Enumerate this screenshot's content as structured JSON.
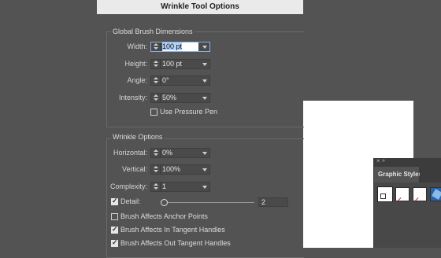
{
  "dialog": {
    "title": "Wrinkle Tool Options"
  },
  "global_brush": {
    "title": "Global Brush Dimensions",
    "width": {
      "label": "Width:",
      "value": "100 pt"
    },
    "height": {
      "label": "Height:",
      "value": "100 pt"
    },
    "angle": {
      "label": "Angle:",
      "value": "0°"
    },
    "intensity": {
      "label": "Intensity:",
      "value": "50%"
    },
    "pressure_pen": {
      "label": "Use Pressure Pen",
      "checked": false
    }
  },
  "wrinkle": {
    "title": "Wrinkle Options",
    "horizontal": {
      "label": "Horizontal:",
      "value": "0%"
    },
    "vertical": {
      "label": "Vertical:",
      "value": "100%"
    },
    "complexity": {
      "label": "Complexity:",
      "value": "1"
    },
    "detail": {
      "label": "Detail:",
      "value": "2",
      "checked": true,
      "slider_fraction": 0.0
    },
    "anchor_points": {
      "label": "Brush Affects Anchor Points",
      "checked": false
    },
    "in_tangent": {
      "label": "Brush Affects In Tangent Handles",
      "checked": true
    },
    "out_tangent": {
      "label": "Brush Affects Out Tangent Handles",
      "checked": true
    }
  },
  "graphic_styles": {
    "tab_label": "Graphic Styles",
    "close_glyph": "×",
    "collapse_glyph": "»"
  },
  "colors": {
    "background": "#535353",
    "title_bar": "#eaeaea",
    "focus": "#8ab0e0",
    "selection": "#b3d1f7"
  }
}
